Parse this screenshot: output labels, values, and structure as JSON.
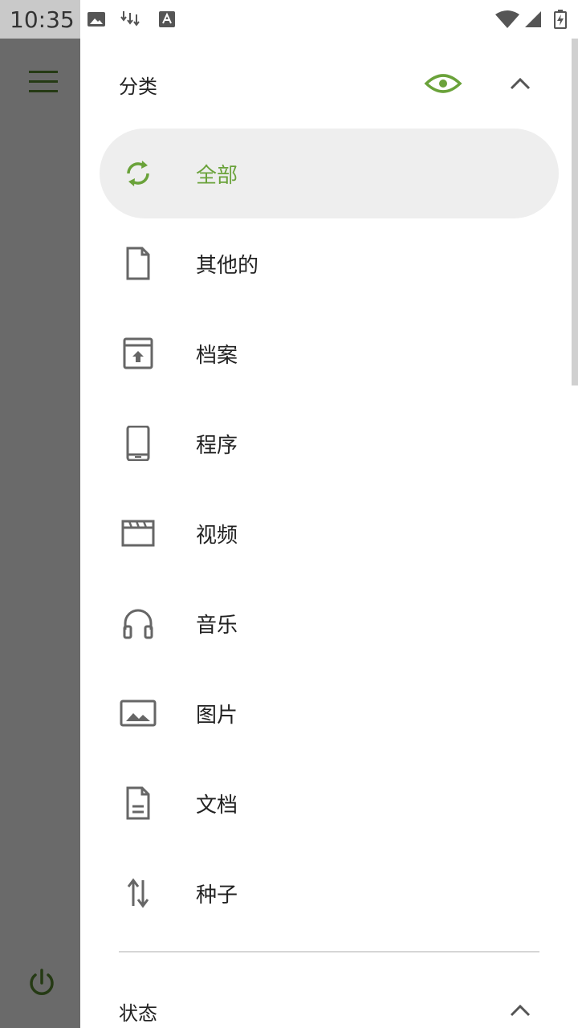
{
  "status_bar": {
    "time": "10:35"
  },
  "drawer": {
    "categories": {
      "title": "分类",
      "items": [
        {
          "label": "全部",
          "icon": "refresh-icon",
          "active": true
        },
        {
          "label": "其他的",
          "icon": "file-icon"
        },
        {
          "label": "档案",
          "icon": "archive-icon"
        },
        {
          "label": "程序",
          "icon": "phone-icon"
        },
        {
          "label": "视频",
          "icon": "video-icon"
        },
        {
          "label": "音乐",
          "icon": "headphones-icon"
        },
        {
          "label": "图片",
          "icon": "image-icon"
        },
        {
          "label": "文档",
          "icon": "document-icon"
        },
        {
          "label": "种子",
          "icon": "swap-icon"
        }
      ]
    },
    "status": {
      "title": "状态"
    }
  },
  "colors": {
    "accent": "#6aa23a",
    "rail": "#6a6a6a",
    "rail_icon": "#253a14"
  }
}
